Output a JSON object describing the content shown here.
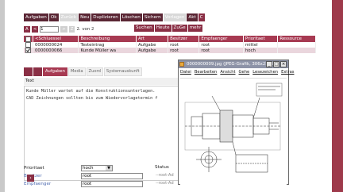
{
  "toolbar": [
    {
      "label": "Aufgaben",
      "state": "normal"
    },
    {
      "label": "Ok",
      "state": "normal"
    },
    {
      "label": "Zurück",
      "state": "disabled"
    },
    {
      "label": "Neu",
      "state": "normal"
    },
    {
      "label": "Duplizieren",
      "state": "normal"
    },
    {
      "label": "Löschen",
      "state": "normal"
    },
    {
      "label": "Sichern",
      "state": "normal"
    },
    {
      "label": "Vorlagen",
      "state": "disabled"
    },
    {
      "label": "Akt",
      "state": "normal"
    },
    {
      "label": "C",
      "state": "active"
    }
  ],
  "pager": {
    "first": "A",
    "prev": "<",
    "page_value": "1",
    "next_disabled": ">",
    "last_disabled": "Z",
    "page_text": "2. von 2"
  },
  "search_buttons": [
    "Suchen",
    "Heute",
    "ZuGe",
    "mehr"
  ],
  "table": {
    "headers": [
      "<Schluessel",
      "Beschreibung",
      "Art",
      "Besitzer",
      "Empfaenger",
      "Prioritaet",
      "Ressource"
    ],
    "rows": [
      {
        "checked": false,
        "cells": [
          "0000000024",
          "Testeintrag",
          "Aufgabe",
          "root",
          "root",
          "mittel",
          ""
        ]
      },
      {
        "checked": true,
        "cells": [
          "0000000066",
          "Kunde Müller wa",
          "Aufgabe",
          "root",
          "root",
          "hoch",
          ""
        ]
      }
    ]
  },
  "detail_tabs": [
    "Aufgaben",
    "Media",
    "Zuord",
    "Systemauskunft"
  ],
  "text_label": "Text",
  "text_lines": [
    "Kunde Müller wartet auf die Konstruktionsunterlagen.",
    "",
    "CAD Zeichnungen sollten bis zum Wiedervorlagetermin f"
  ],
  "form": {
    "prioritaet_label": "Prioritaet",
    "prioritaet_value": "hoch",
    "besitzer_label": "Besitzer",
    "besitzer_value": "root",
    "empfaenger_label": "Empfaenger",
    "empfaenger_value": "root",
    "status_label": "Status",
    "status_values": [
      "--root-Ad",
      "--root-Ad"
    ]
  },
  "image_window": {
    "title": "0000000009.jpg (JPEG-Grafik, 306x253 Pix...",
    "menu": [
      "Datei",
      "Bearbeiten",
      "Ansicht",
      "Gehe",
      "Lesezeichen",
      "Extras"
    ],
    "min": "_",
    "max": "□",
    "close": "×"
  },
  "colors": {
    "accent": "#a73a52",
    "dark_accent": "#5a2634",
    "side_strip": "#9e3a4b",
    "window_title": "#8d93a7"
  }
}
